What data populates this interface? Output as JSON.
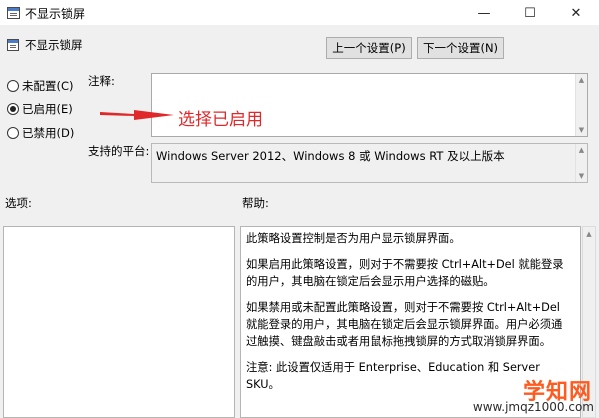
{
  "window": {
    "title": "不显示锁屏",
    "controls": {
      "minimize": "—",
      "maximize": "☐",
      "close": "✕"
    }
  },
  "header": {
    "policy_name": "不显示锁屏",
    "prev_button": "上一个设置(P)",
    "next_button": "下一个设置(N)"
  },
  "state": {
    "options": [
      {
        "label": "未配置(C)",
        "selected": false
      },
      {
        "label": "已启用(E)",
        "selected": true
      },
      {
        "label": "已禁用(D)",
        "selected": false
      }
    ]
  },
  "comment": {
    "label": "注释:",
    "value": ""
  },
  "platform": {
    "label": "支持的平台:",
    "value": "Windows Server 2012、Windows 8 或 Windows RT 及以上版本"
  },
  "options_section": {
    "label": "选项:"
  },
  "help_section": {
    "label": "帮助:",
    "paragraphs": [
      "此策略设置控制是否为用户显示锁屏界面。",
      "如果启用此策略设置，则对于不需要按 Ctrl+Alt+Del 就能登录的用户，其电脑在锁定后会显示用户选择的磁贴。",
      "如果禁用或未配置此策略设置，则对于不需要按 Ctrl+Alt+Del 就能登录的用户，其电脑在锁定后会显示锁屏界面。用户必须通过触摸、键盘敲击或者用鼠标拖拽锁屏的方式取消锁屏界面。",
      "注意: 此设置仅适用于 Enterprise、Education 和 Server SKU。"
    ]
  },
  "annotation": {
    "text": "选择已启用",
    "color": "#e0282a"
  },
  "watermark": {
    "text": "学知网",
    "url": "www.jmqz1000.com"
  }
}
